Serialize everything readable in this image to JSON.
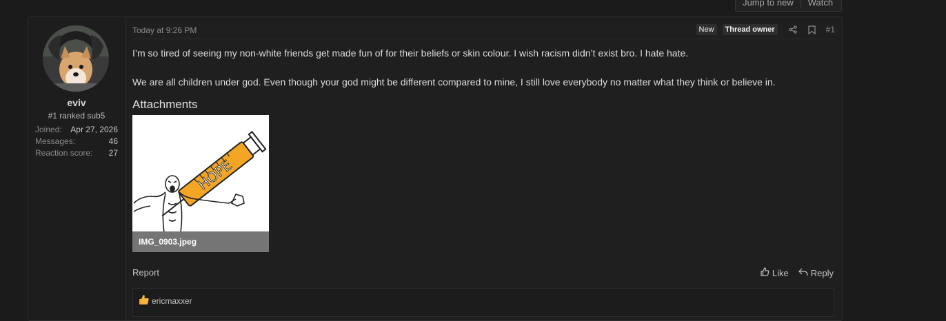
{
  "topbar": {
    "jump_label": "Jump to new",
    "watch_label": "Watch"
  },
  "post": {
    "user": {
      "name": "eviv",
      "title": "#1 ranked sub5",
      "stats": [
        {
          "label": "Joined:",
          "value": "Apr 27, 2026"
        },
        {
          "label": "Messages:",
          "value": "46"
        },
        {
          "label": "Reaction score:",
          "value": "27"
        }
      ]
    },
    "time": "Today at 9:26 PM",
    "badges": {
      "new": "New",
      "owner": "Thread owner"
    },
    "post_number": "#1",
    "body": [
      "I’m so tired of seeing my non-white friends get made fun of for their beliefs or skin colour. I wish racism didn’t exist bro. I hate hate.",
      "We are all children under god. Even though your god might be different compared to mine, I still love everybody no matter what they think or believe in."
    ],
    "attachments_heading": "Attachments",
    "attachment": {
      "filename": "IMG_0903.jpeg",
      "art_text": "HOPE"
    },
    "report_label": "Report",
    "like_label": "Like",
    "reply_label": "Reply",
    "reaction_user": "ericmaxxer"
  },
  "colors": {
    "background": "#1b1b1b",
    "post_bg": "#1f1f1f",
    "syringe": "#f3a623"
  },
  "icons": [
    "share-icon",
    "bookmark-icon",
    "thumbs-up-icon",
    "reply-icon"
  ]
}
